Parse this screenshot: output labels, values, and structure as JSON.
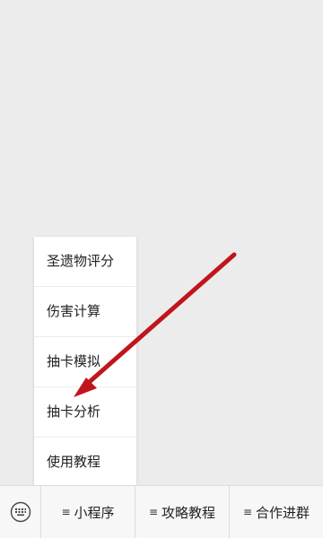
{
  "popup_menu": {
    "items": [
      {
        "label": "圣遗物评分"
      },
      {
        "label": "伤害计算"
      },
      {
        "label": "抽卡模拟"
      },
      {
        "label": "抽卡分析"
      },
      {
        "label": "使用教程"
      }
    ]
  },
  "bottom_menu": {
    "keyboard_icon": "keyboard-icon",
    "buttons": [
      {
        "label": "小程序",
        "icon": "hamburger-icon"
      },
      {
        "label": "攻略教程",
        "icon": "hamburger-icon"
      },
      {
        "label": "合作进群",
        "icon": "hamburger-icon"
      }
    ]
  },
  "annotation": {
    "arrow_color": "#c0161b"
  }
}
